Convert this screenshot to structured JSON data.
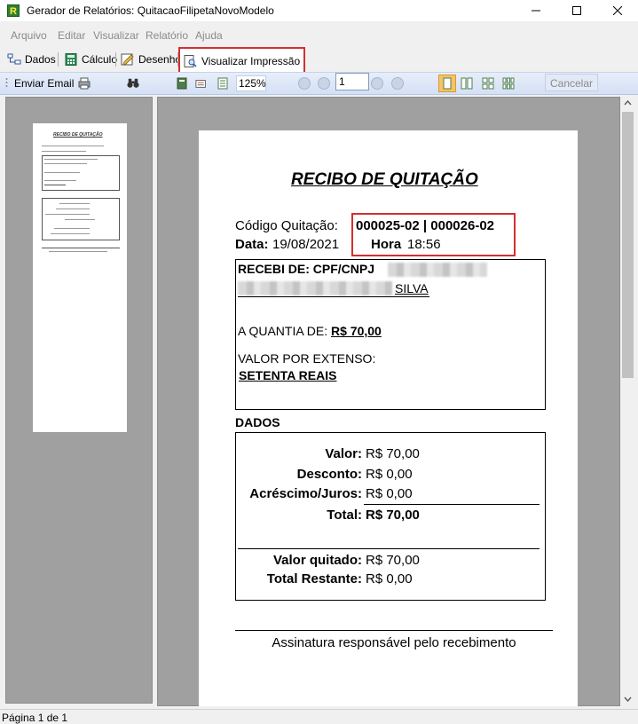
{
  "window": {
    "title": "Gerador de Relatórios: QuitacaoFilipetaNovoModelo"
  },
  "menu": {
    "items": [
      "Arquivo",
      "Editar",
      "Visualizar",
      "Relatório",
      "Ajuda"
    ]
  },
  "tabs": {
    "dados": "Dados",
    "calculo": "Cálculo",
    "desenho": "Desenho",
    "visualizar": "Visualizar Impressão"
  },
  "preview_toolbar": {
    "send_email": "Enviar Email",
    "zoom": "125%",
    "page_number": "1",
    "cancel": "Cancelar"
  },
  "receipt": {
    "title": "RECIBO DE QUITAÇÃO",
    "codigo_label": "Código Quitação:",
    "codigo_value": "000025-02 | 000026-02",
    "data_label": "Data:",
    "data_value": "19/08/2021",
    "hora_label": "Hora",
    "hora_value": "18:56",
    "recebi_label": "RECEBI DE:  CPF/CNPJ",
    "recebi_name_suffix": "SILVA",
    "quantia_label": "A QUANTIA DE:",
    "quantia_value": "R$ 70,00",
    "extenso_label": "VALOR POR EXTENSO:",
    "extenso_value": "SETENTA REAIS",
    "dados_label": "DADOS",
    "valor_label": "Valor:",
    "valor_value": "R$ 70,00",
    "desconto_label": "Desconto:",
    "desconto_value": "R$ 0,00",
    "acrescimo_label": "Acréscimo/Juros:",
    "acrescimo_value": "R$ 0,00",
    "total_label": "Total:",
    "total_value": "R$ 70,00",
    "quitado_label": "Valor quitado:",
    "quitado_value": "R$ 70,00",
    "restante_label": "Total Restante:",
    "restante_value": "R$ 0,00",
    "assinatura": "Assinatura responsável pelo recebimento"
  },
  "status": {
    "page_info": "Página 1 de 1"
  }
}
